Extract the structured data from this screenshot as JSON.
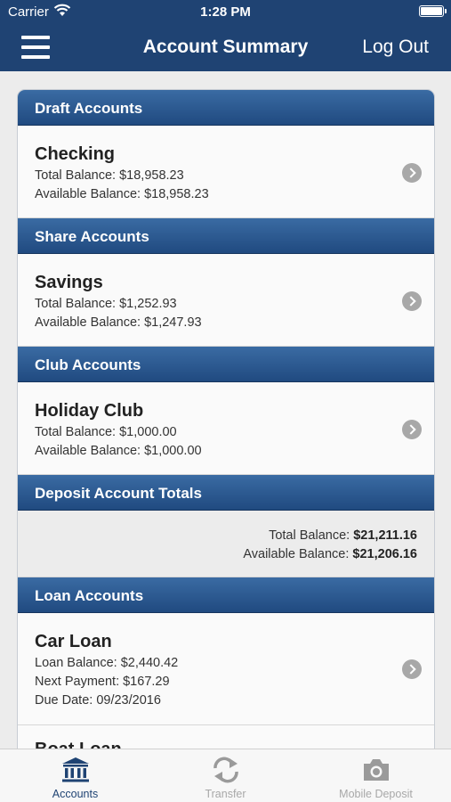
{
  "status_bar": {
    "carrier": "Carrier",
    "time": "1:28 PM",
    "wifi_icon": "wifi-icon",
    "battery_icon": "battery-icon"
  },
  "nav": {
    "menu_icon": "hamburger-menu-icon",
    "title": "Account Summary",
    "logout_label": "Log Out"
  },
  "sections": {
    "draft": {
      "header": "Draft Accounts",
      "accounts": [
        {
          "name": "Checking",
          "total_balance": "Total Balance: $18,958.23",
          "available_balance": "Available Balance: $18,958.23"
        }
      ]
    },
    "share": {
      "header": "Share Accounts",
      "accounts": [
        {
          "name": "Savings",
          "total_balance": "Total Balance: $1,252.93",
          "available_balance": "Available Balance: $1,247.93"
        }
      ]
    },
    "club": {
      "header": "Club Accounts",
      "accounts": [
        {
          "name": "Holiday Club",
          "total_balance": "Total Balance: $1,000.00",
          "available_balance": "Available Balance: $1,000.00"
        }
      ]
    },
    "deposit_totals": {
      "header": "Deposit Account Totals",
      "total_label": "Total Balance:",
      "total_value": "$21,211.16",
      "available_label": "Available Balance:",
      "available_value": "$21,206.16"
    },
    "loan": {
      "header": "Loan Accounts",
      "accounts": [
        {
          "name": "Car Loan",
          "loan_balance": "Loan Balance: $2,440.42",
          "next_payment": "Next Payment: $167.29",
          "due_date": "Due Date: 09/23/2016"
        },
        {
          "name": "Boat Loan"
        }
      ]
    }
  },
  "tabs": [
    {
      "label": "Accounts",
      "icon": "bank-icon",
      "active": true
    },
    {
      "label": "Transfer",
      "icon": "transfer-arrows-icon",
      "active": false
    },
    {
      "label": "Mobile Deposit",
      "icon": "camera-icon",
      "active": false
    }
  ],
  "colors": {
    "nav_blue": "#1f4373",
    "header_gradient_top": "#3a6ba3",
    "header_gradient_bottom": "#204a80",
    "chevron_gray": "#a8a8a8"
  }
}
